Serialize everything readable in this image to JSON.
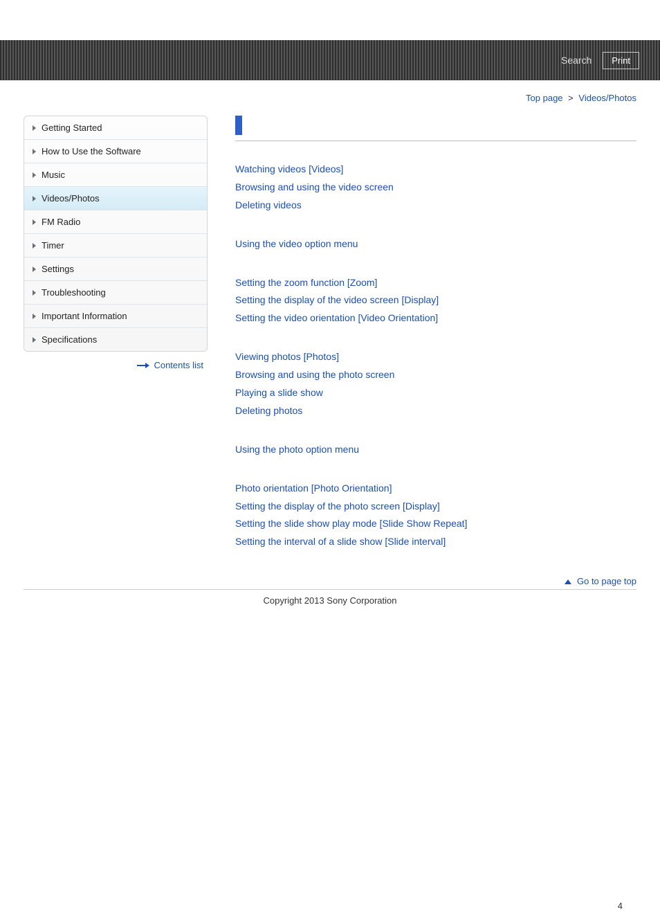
{
  "header": {
    "search_placeholder": "Search",
    "print_label": "Print"
  },
  "breadcrumb": {
    "top_page": "Top page",
    "current": "Videos/Photos"
  },
  "sidebar": {
    "items": [
      {
        "label": "Getting Started",
        "active": false
      },
      {
        "label": "How to Use the Software",
        "active": false
      },
      {
        "label": "Music",
        "active": false
      },
      {
        "label": "Videos/Photos",
        "active": true
      },
      {
        "label": "FM Radio",
        "active": false
      },
      {
        "label": "Timer",
        "active": false
      },
      {
        "label": "Settings",
        "active": false
      },
      {
        "label": "Troubleshooting",
        "active": false
      },
      {
        "label": "Important Information",
        "active": false
      },
      {
        "label": "Specifications",
        "active": false
      }
    ],
    "contents_list_label": "Contents list"
  },
  "main": {
    "heading": "",
    "groups": [
      [
        "Watching videos [Videos]",
        "Browsing and using the video screen",
        "Deleting videos"
      ],
      [
        "Using the video option menu"
      ],
      [
        "Setting the zoom function [Zoom]",
        "Setting the display of the video screen [Display]",
        "Setting the video orientation [Video Orientation]"
      ],
      [
        "Viewing photos [Photos]",
        "Browsing and using the photo screen",
        "Playing a slide show",
        "Deleting photos"
      ],
      [
        "Using the photo option menu"
      ],
      [
        "Photo orientation [Photo Orientation]",
        "Setting the display of the photo screen [Display]",
        "Setting the slide show play mode [Slide Show Repeat]",
        "Setting the interval of a slide show [Slide interval]"
      ]
    ]
  },
  "footer": {
    "go_top_label": "Go to page top",
    "copyright": "Copyright 2013 Sony Corporation",
    "page_number": "4"
  }
}
